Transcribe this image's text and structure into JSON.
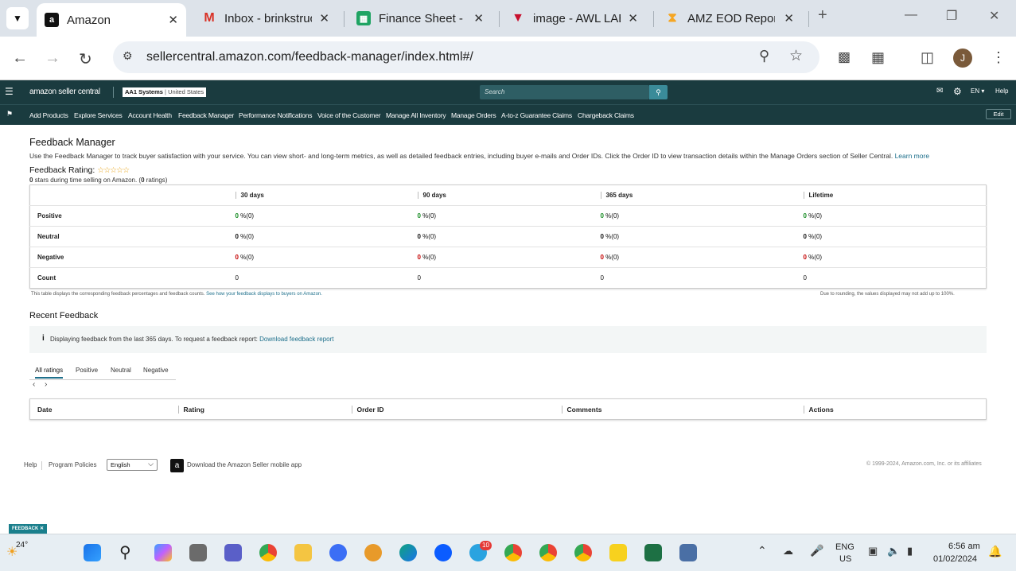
{
  "browser": {
    "tabs": [
      {
        "title": "Amazon",
        "icon": "amazon-icon",
        "active": true
      },
      {
        "title": "Inbox - brinkstruc",
        "icon": "gmail-icon",
        "active": false
      },
      {
        "title": "Finance Sheet - a",
        "icon": "sheets-icon",
        "active": false
      },
      {
        "title": "image - AWL LAB",
        "icon": "awl-icon",
        "active": false
      },
      {
        "title": "AMZ EOD Report",
        "icon": "report-icon",
        "active": false
      }
    ],
    "url": "sellercentral.amazon.com/feedback-manager/index.html#/",
    "profile_initial": "J"
  },
  "header": {
    "logo": "amazon seller central",
    "account": "AA1 Systems",
    "region": "United States",
    "search_placeholder": "Search",
    "language": "EN",
    "help": "Help"
  },
  "nav": {
    "items": [
      "Add Products",
      "Explore Services",
      "Account Health",
      "Feedback Manager",
      "Performance Notifications",
      "Voice of the Customer",
      "Manage All Inventory",
      "Manage Orders",
      "A-to-z Guarantee Claims",
      "Chargeback Claims"
    ],
    "edit": "Edit"
  },
  "page": {
    "title": "Feedback Manager",
    "description": "Use the Feedback Manager to track buyer satisfaction with your service. You can view short- and long-term metrics, as well as detailed feedback entries, including buyer e-mails and Order IDs. Click the Order ID to view transaction details within the Manage Orders section of Seller Central.",
    "learn_more": "Learn more",
    "rating_label": "Feedback Rating:",
    "rating_stars": 0,
    "rating_summary_a": "0",
    "rating_summary_b": " stars during time selling on Amazon. (",
    "rating_summary_c": "0",
    "rating_summary_d": " ratings)"
  },
  "metrics": {
    "columns": [
      "30 days",
      "90 days",
      "365 days",
      "Lifetime"
    ],
    "rows": [
      {
        "label": "Positive",
        "values": [
          "0",
          "0",
          "0",
          "0"
        ],
        "suffix": " %(0)"
      },
      {
        "label": "Neutral",
        "values": [
          "0",
          "0",
          "0",
          "0"
        ],
        "suffix": " %(0)"
      },
      {
        "label": "Negative",
        "values": [
          "0",
          "0",
          "0",
          "0"
        ],
        "suffix": " %(0)"
      },
      {
        "label": "Count",
        "values": [
          "0",
          "0",
          "0",
          "0"
        ],
        "suffix": ""
      }
    ],
    "note_left": "This table displays the corresponding feedback percentages and feedback counts.",
    "note_left_link": "See how your feedback displays to buyers on Amazon.",
    "note_right": "Due to rounding, the values displayed may not add up to 100%."
  },
  "recent": {
    "title": "Recent Feedback",
    "info": "Displaying feedback from the last 365 days. To request a feedback report:",
    "info_link": "Download feedback report",
    "filters": [
      "All ratings",
      "Positive",
      "Neutral",
      "Negative"
    ],
    "columns": [
      "Date",
      "Rating",
      "Order ID",
      "Comments",
      "Actions"
    ]
  },
  "footer": {
    "help": "Help",
    "policies": "Program Policies",
    "language": "English",
    "app": "Download the Amazon Seller mobile app",
    "copyright": "© 1999-2024, Amazon.com, Inc. or its affiliates"
  },
  "feedback_badge": "FEEDBACK",
  "taskbar": {
    "weather": "24°",
    "lang": "ENG",
    "region": "US",
    "time": "6:56 am",
    "date": "01/02/2024",
    "telegram_badge": "10"
  },
  "colors": {
    "header_bg": "#1a3b3f",
    "positive": "#138a20",
    "negative": "#c40000",
    "link": "#1d6f8b"
  }
}
